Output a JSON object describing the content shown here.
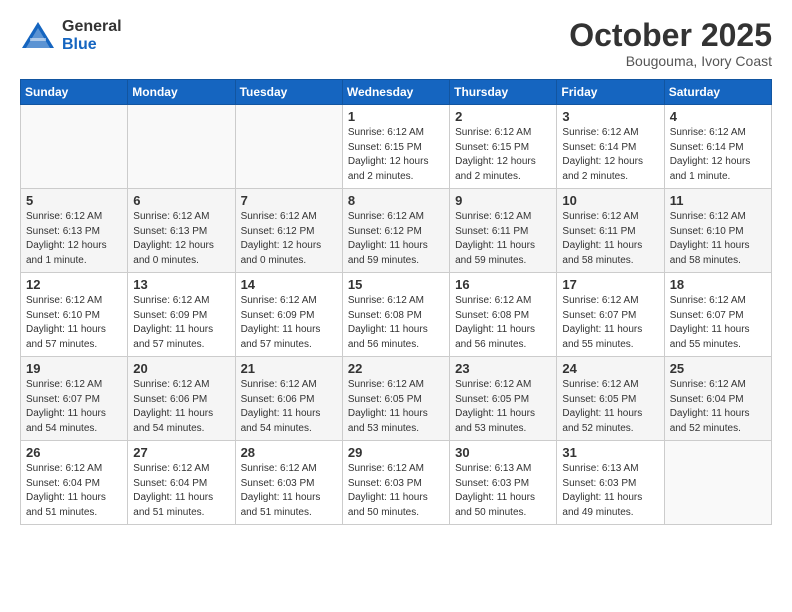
{
  "header": {
    "logo_general": "General",
    "logo_blue": "Blue",
    "month_title": "October 2025",
    "location": "Bougouma, Ivory Coast"
  },
  "weekdays": [
    "Sunday",
    "Monday",
    "Tuesday",
    "Wednesday",
    "Thursday",
    "Friday",
    "Saturday"
  ],
  "weeks": [
    [
      {
        "day": "",
        "info": ""
      },
      {
        "day": "",
        "info": ""
      },
      {
        "day": "",
        "info": ""
      },
      {
        "day": "1",
        "info": "Sunrise: 6:12 AM\nSunset: 6:15 PM\nDaylight: 12 hours\nand 2 minutes."
      },
      {
        "day": "2",
        "info": "Sunrise: 6:12 AM\nSunset: 6:15 PM\nDaylight: 12 hours\nand 2 minutes."
      },
      {
        "day": "3",
        "info": "Sunrise: 6:12 AM\nSunset: 6:14 PM\nDaylight: 12 hours\nand 2 minutes."
      },
      {
        "day": "4",
        "info": "Sunrise: 6:12 AM\nSunset: 6:14 PM\nDaylight: 12 hours\nand 1 minute."
      }
    ],
    [
      {
        "day": "5",
        "info": "Sunrise: 6:12 AM\nSunset: 6:13 PM\nDaylight: 12 hours\nand 1 minute."
      },
      {
        "day": "6",
        "info": "Sunrise: 6:12 AM\nSunset: 6:13 PM\nDaylight: 12 hours\nand 0 minutes."
      },
      {
        "day": "7",
        "info": "Sunrise: 6:12 AM\nSunset: 6:12 PM\nDaylight: 12 hours\nand 0 minutes."
      },
      {
        "day": "8",
        "info": "Sunrise: 6:12 AM\nSunset: 6:12 PM\nDaylight: 11 hours\nand 59 minutes."
      },
      {
        "day": "9",
        "info": "Sunrise: 6:12 AM\nSunset: 6:11 PM\nDaylight: 11 hours\nand 59 minutes."
      },
      {
        "day": "10",
        "info": "Sunrise: 6:12 AM\nSunset: 6:11 PM\nDaylight: 11 hours\nand 58 minutes."
      },
      {
        "day": "11",
        "info": "Sunrise: 6:12 AM\nSunset: 6:10 PM\nDaylight: 11 hours\nand 58 minutes."
      }
    ],
    [
      {
        "day": "12",
        "info": "Sunrise: 6:12 AM\nSunset: 6:10 PM\nDaylight: 11 hours\nand 57 minutes."
      },
      {
        "day": "13",
        "info": "Sunrise: 6:12 AM\nSunset: 6:09 PM\nDaylight: 11 hours\nand 57 minutes."
      },
      {
        "day": "14",
        "info": "Sunrise: 6:12 AM\nSunset: 6:09 PM\nDaylight: 11 hours\nand 57 minutes."
      },
      {
        "day": "15",
        "info": "Sunrise: 6:12 AM\nSunset: 6:08 PM\nDaylight: 11 hours\nand 56 minutes."
      },
      {
        "day": "16",
        "info": "Sunrise: 6:12 AM\nSunset: 6:08 PM\nDaylight: 11 hours\nand 56 minutes."
      },
      {
        "day": "17",
        "info": "Sunrise: 6:12 AM\nSunset: 6:07 PM\nDaylight: 11 hours\nand 55 minutes."
      },
      {
        "day": "18",
        "info": "Sunrise: 6:12 AM\nSunset: 6:07 PM\nDaylight: 11 hours\nand 55 minutes."
      }
    ],
    [
      {
        "day": "19",
        "info": "Sunrise: 6:12 AM\nSunset: 6:07 PM\nDaylight: 11 hours\nand 54 minutes."
      },
      {
        "day": "20",
        "info": "Sunrise: 6:12 AM\nSunset: 6:06 PM\nDaylight: 11 hours\nand 54 minutes."
      },
      {
        "day": "21",
        "info": "Sunrise: 6:12 AM\nSunset: 6:06 PM\nDaylight: 11 hours\nand 54 minutes."
      },
      {
        "day": "22",
        "info": "Sunrise: 6:12 AM\nSunset: 6:05 PM\nDaylight: 11 hours\nand 53 minutes."
      },
      {
        "day": "23",
        "info": "Sunrise: 6:12 AM\nSunset: 6:05 PM\nDaylight: 11 hours\nand 53 minutes."
      },
      {
        "day": "24",
        "info": "Sunrise: 6:12 AM\nSunset: 6:05 PM\nDaylight: 11 hours\nand 52 minutes."
      },
      {
        "day": "25",
        "info": "Sunrise: 6:12 AM\nSunset: 6:04 PM\nDaylight: 11 hours\nand 52 minutes."
      }
    ],
    [
      {
        "day": "26",
        "info": "Sunrise: 6:12 AM\nSunset: 6:04 PM\nDaylight: 11 hours\nand 51 minutes."
      },
      {
        "day": "27",
        "info": "Sunrise: 6:12 AM\nSunset: 6:04 PM\nDaylight: 11 hours\nand 51 minutes."
      },
      {
        "day": "28",
        "info": "Sunrise: 6:12 AM\nSunset: 6:03 PM\nDaylight: 11 hours\nand 51 minutes."
      },
      {
        "day": "29",
        "info": "Sunrise: 6:12 AM\nSunset: 6:03 PM\nDaylight: 11 hours\nand 50 minutes."
      },
      {
        "day": "30",
        "info": "Sunrise: 6:13 AM\nSunset: 6:03 PM\nDaylight: 11 hours\nand 50 minutes."
      },
      {
        "day": "31",
        "info": "Sunrise: 6:13 AM\nSunset: 6:03 PM\nDaylight: 11 hours\nand 49 minutes."
      },
      {
        "day": "",
        "info": ""
      }
    ]
  ]
}
